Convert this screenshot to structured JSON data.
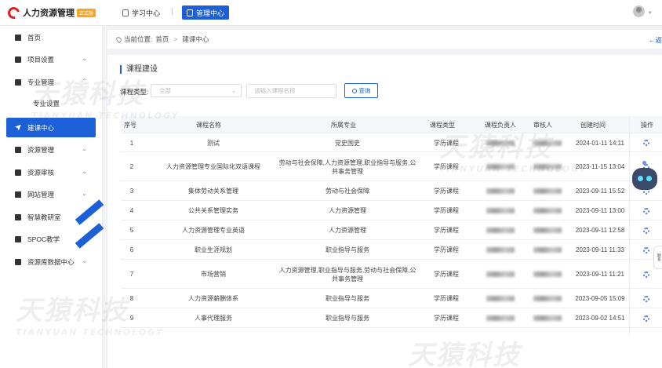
{
  "app": {
    "title": "人力资源管理",
    "badge": "正式版"
  },
  "topnav": {
    "study": "学习中心",
    "separator": "|",
    "manage": "管理中心"
  },
  "sidebar": {
    "items": [
      {
        "label": "首页",
        "icon": "home-icon",
        "arrow": ""
      },
      {
        "label": "项目设置",
        "icon": "folder-icon",
        "arrow": "⌄"
      },
      {
        "label": "专业管理",
        "icon": "book-icon",
        "arrow": "⌃"
      },
      {
        "label": "专业设置",
        "icon": "",
        "arrow": ""
      },
      {
        "label": "建课中心",
        "icon": "send-icon",
        "arrow": ""
      },
      {
        "label": "资源管理",
        "icon": "gear-icon",
        "arrow": "⌄"
      },
      {
        "label": "资源审核",
        "icon": "folder-icon",
        "arrow": "⌄"
      },
      {
        "label": "网站管理",
        "icon": "monitor-icon",
        "arrow": "⌄"
      },
      {
        "label": "智慧教研室",
        "icon": "clipboard-icon",
        "arrow": ""
      },
      {
        "label": "SPOC教学",
        "icon": "compass-icon",
        "arrow": ""
      },
      {
        "label": "资源库数据中心",
        "icon": "chart-icon",
        "arrow": "⌄"
      }
    ]
  },
  "breadcrumb": {
    "prefix": "当前位置:",
    "home": "首页",
    "sep": ">",
    "current": "建课中心",
    "back": "←返"
  },
  "panel": {
    "title": "课程建设",
    "filter_label": "课程类型:",
    "select_value": "全部",
    "select_caret": "⌄",
    "input_placeholder": "请输入课程名称",
    "search_label": "查询"
  },
  "table": {
    "headers": [
      "序号",
      "课程名称",
      "所属专业",
      "课程类型",
      "课程负责人",
      "审核人",
      "创建时间",
      "操作"
    ],
    "rows": [
      {
        "no": "1",
        "name": "测试",
        "major": "党史国史",
        "type": "学历课程",
        "time": "2024-01-11 14:11"
      },
      {
        "no": "2",
        "name": "人力资源管理专业国际化双语课程",
        "major": "劳动与社会保障,人力资源管理,职业指导与服务,公共事务管理",
        "type": "学历课程",
        "time": "2023-11-15 13:04"
      },
      {
        "no": "3",
        "name": "集体劳动关系管理",
        "major": "劳动与社会保障",
        "type": "学历课程",
        "time": "2023-09-11 15:52"
      },
      {
        "no": "4",
        "name": "公共关系管理实务",
        "major": "人力资源管理",
        "type": "学历课程",
        "time": "2023-09-11 13:00"
      },
      {
        "no": "5",
        "name": "人力资源管理专业英语",
        "major": "人力资源管理",
        "type": "学历课程",
        "time": "2023-09-11 12:58"
      },
      {
        "no": "6",
        "name": "职业生涯规划",
        "major": "职业指导与服务",
        "type": "学历课程",
        "time": "2023-09-11 11:33"
      },
      {
        "no": "7",
        "name": "市场营销",
        "major": "人力资源管理,职业指导与服务,劳动与社会保障,公共事务管理",
        "type": "学历课程",
        "time": "2023-09-11 11:21"
      },
      {
        "no": "8",
        "name": "人力资源薪酬体系",
        "major": "职业指导与服务",
        "type": "学历课程",
        "time": "2023-09-05 15:09"
      },
      {
        "no": "9",
        "name": "人事代理服务",
        "major": "职业指导与服务",
        "type": "学历课程",
        "time": "2023-09-02 14:51"
      }
    ]
  },
  "floating": {
    "chat": "联系"
  },
  "watermark": {
    "cn": "天猿科技",
    "en": "TIANYUAN TECHNOLOGY"
  },
  "colors": {
    "accent": "#1c5fd6",
    "badge": "#f5a623"
  }
}
